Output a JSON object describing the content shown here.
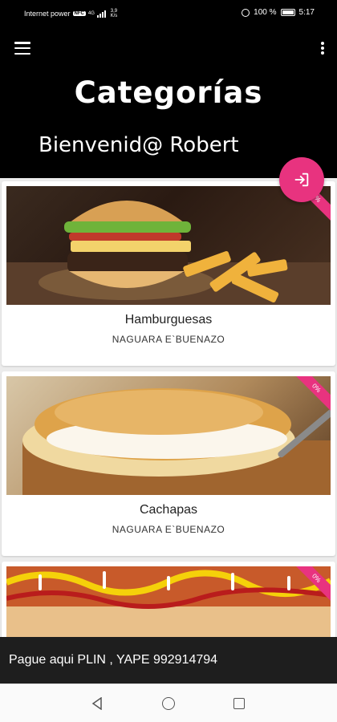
{
  "status_bar": {
    "carrier": "Internet power",
    "network_badge": "NFC",
    "network_type": "4G",
    "speed": "3,9 K/s",
    "battery": "100 %",
    "time": "5:17"
  },
  "header": {
    "title": "Categorías",
    "welcome": "Bienvenid@ Robert"
  },
  "categories": [
    {
      "name": "Hamburguesas",
      "subtitle": "NAGUARA E`BUENAZO",
      "discount": "3%"
    },
    {
      "name": "Cachapas",
      "subtitle": "NAGUARA E`BUENAZO",
      "discount": "0%"
    },
    {
      "name": "",
      "subtitle": "",
      "discount": "0%"
    }
  ],
  "promo": {
    "text": "Pague aqui PLIN , YAPE 992914794"
  },
  "colors": {
    "accent": "#e8337f",
    "header_bg": "#000000",
    "banner_bg": "#1e1e1e"
  },
  "icons": {
    "menu": "menu-icon",
    "more": "more-vert-icon",
    "fab": "login-icon"
  }
}
